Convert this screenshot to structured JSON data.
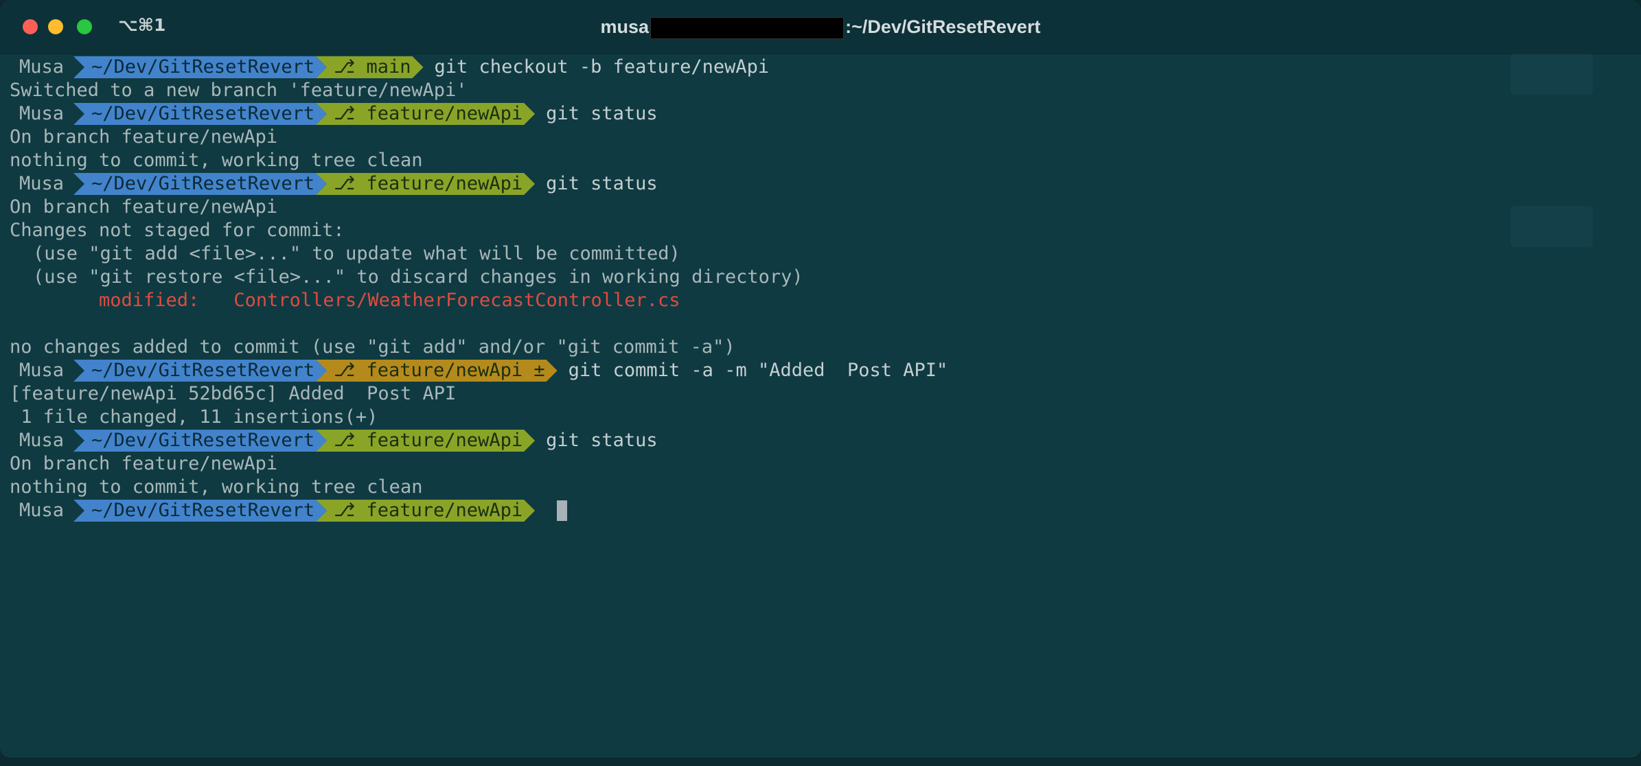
{
  "window": {
    "shortcut": "⌥⌘1",
    "title_prefix": "musa",
    "title_suffix": ":~/Dev/GitResetRevert"
  },
  "colors": {
    "background": "#0f3a42",
    "path_segment": "#4283cc",
    "git_segment": "#8aa428",
    "git_dirty_segment": "#b58a1c",
    "modified_text": "#e04b3f"
  },
  "prompts": [
    {
      "user": "Musa",
      "path": "~/Dev/GitResetRevert",
      "branch": "⎇ main",
      "command": "git checkout -b feature/newApi"
    },
    {
      "user": "Musa",
      "path": "~/Dev/GitResetRevert",
      "branch": "⎇ feature/newApi",
      "command": "git status"
    },
    {
      "user": "Musa",
      "path": "~/Dev/GitResetRevert",
      "branch": "⎇ feature/newApi",
      "command": "git status"
    },
    {
      "user": "Musa",
      "path": "~/Dev/GitResetRevert",
      "branch": "⎇ feature/newApi ±",
      "command": "git commit -a -m \"Added  Post API\""
    },
    {
      "user": "Musa",
      "path": "~/Dev/GitResetRevert",
      "branch": "⎇ feature/newApi",
      "command": "git status"
    },
    {
      "user": "Musa",
      "path": "~/Dev/GitResetRevert",
      "branch": "⎇ feature/newApi",
      "command": ""
    }
  ],
  "output": {
    "o1": "Switched to a new branch 'feature/newApi'",
    "o2": "On branch feature/newApi",
    "o3": "nothing to commit, working tree clean",
    "o4": "On branch feature/newApi",
    "o5": "Changes not staged for commit:",
    "o6": "(use \"git add <file>...\" to update what will be committed)",
    "o7": "(use \"git restore <file>...\" to discard changes in working directory)",
    "o8_label": "modified:",
    "o8_file": "Controllers/WeatherForecastController.cs",
    "o9": "no changes added to commit (use \"git add\" and/or \"git commit -a\")",
    "o10": "[feature/newApi 52bd65c] Added  Post API",
    "o11": " 1 file changed, 11 insertions(+)",
    "o12": "On branch feature/newApi",
    "o13": "nothing to commit, working tree clean"
  }
}
